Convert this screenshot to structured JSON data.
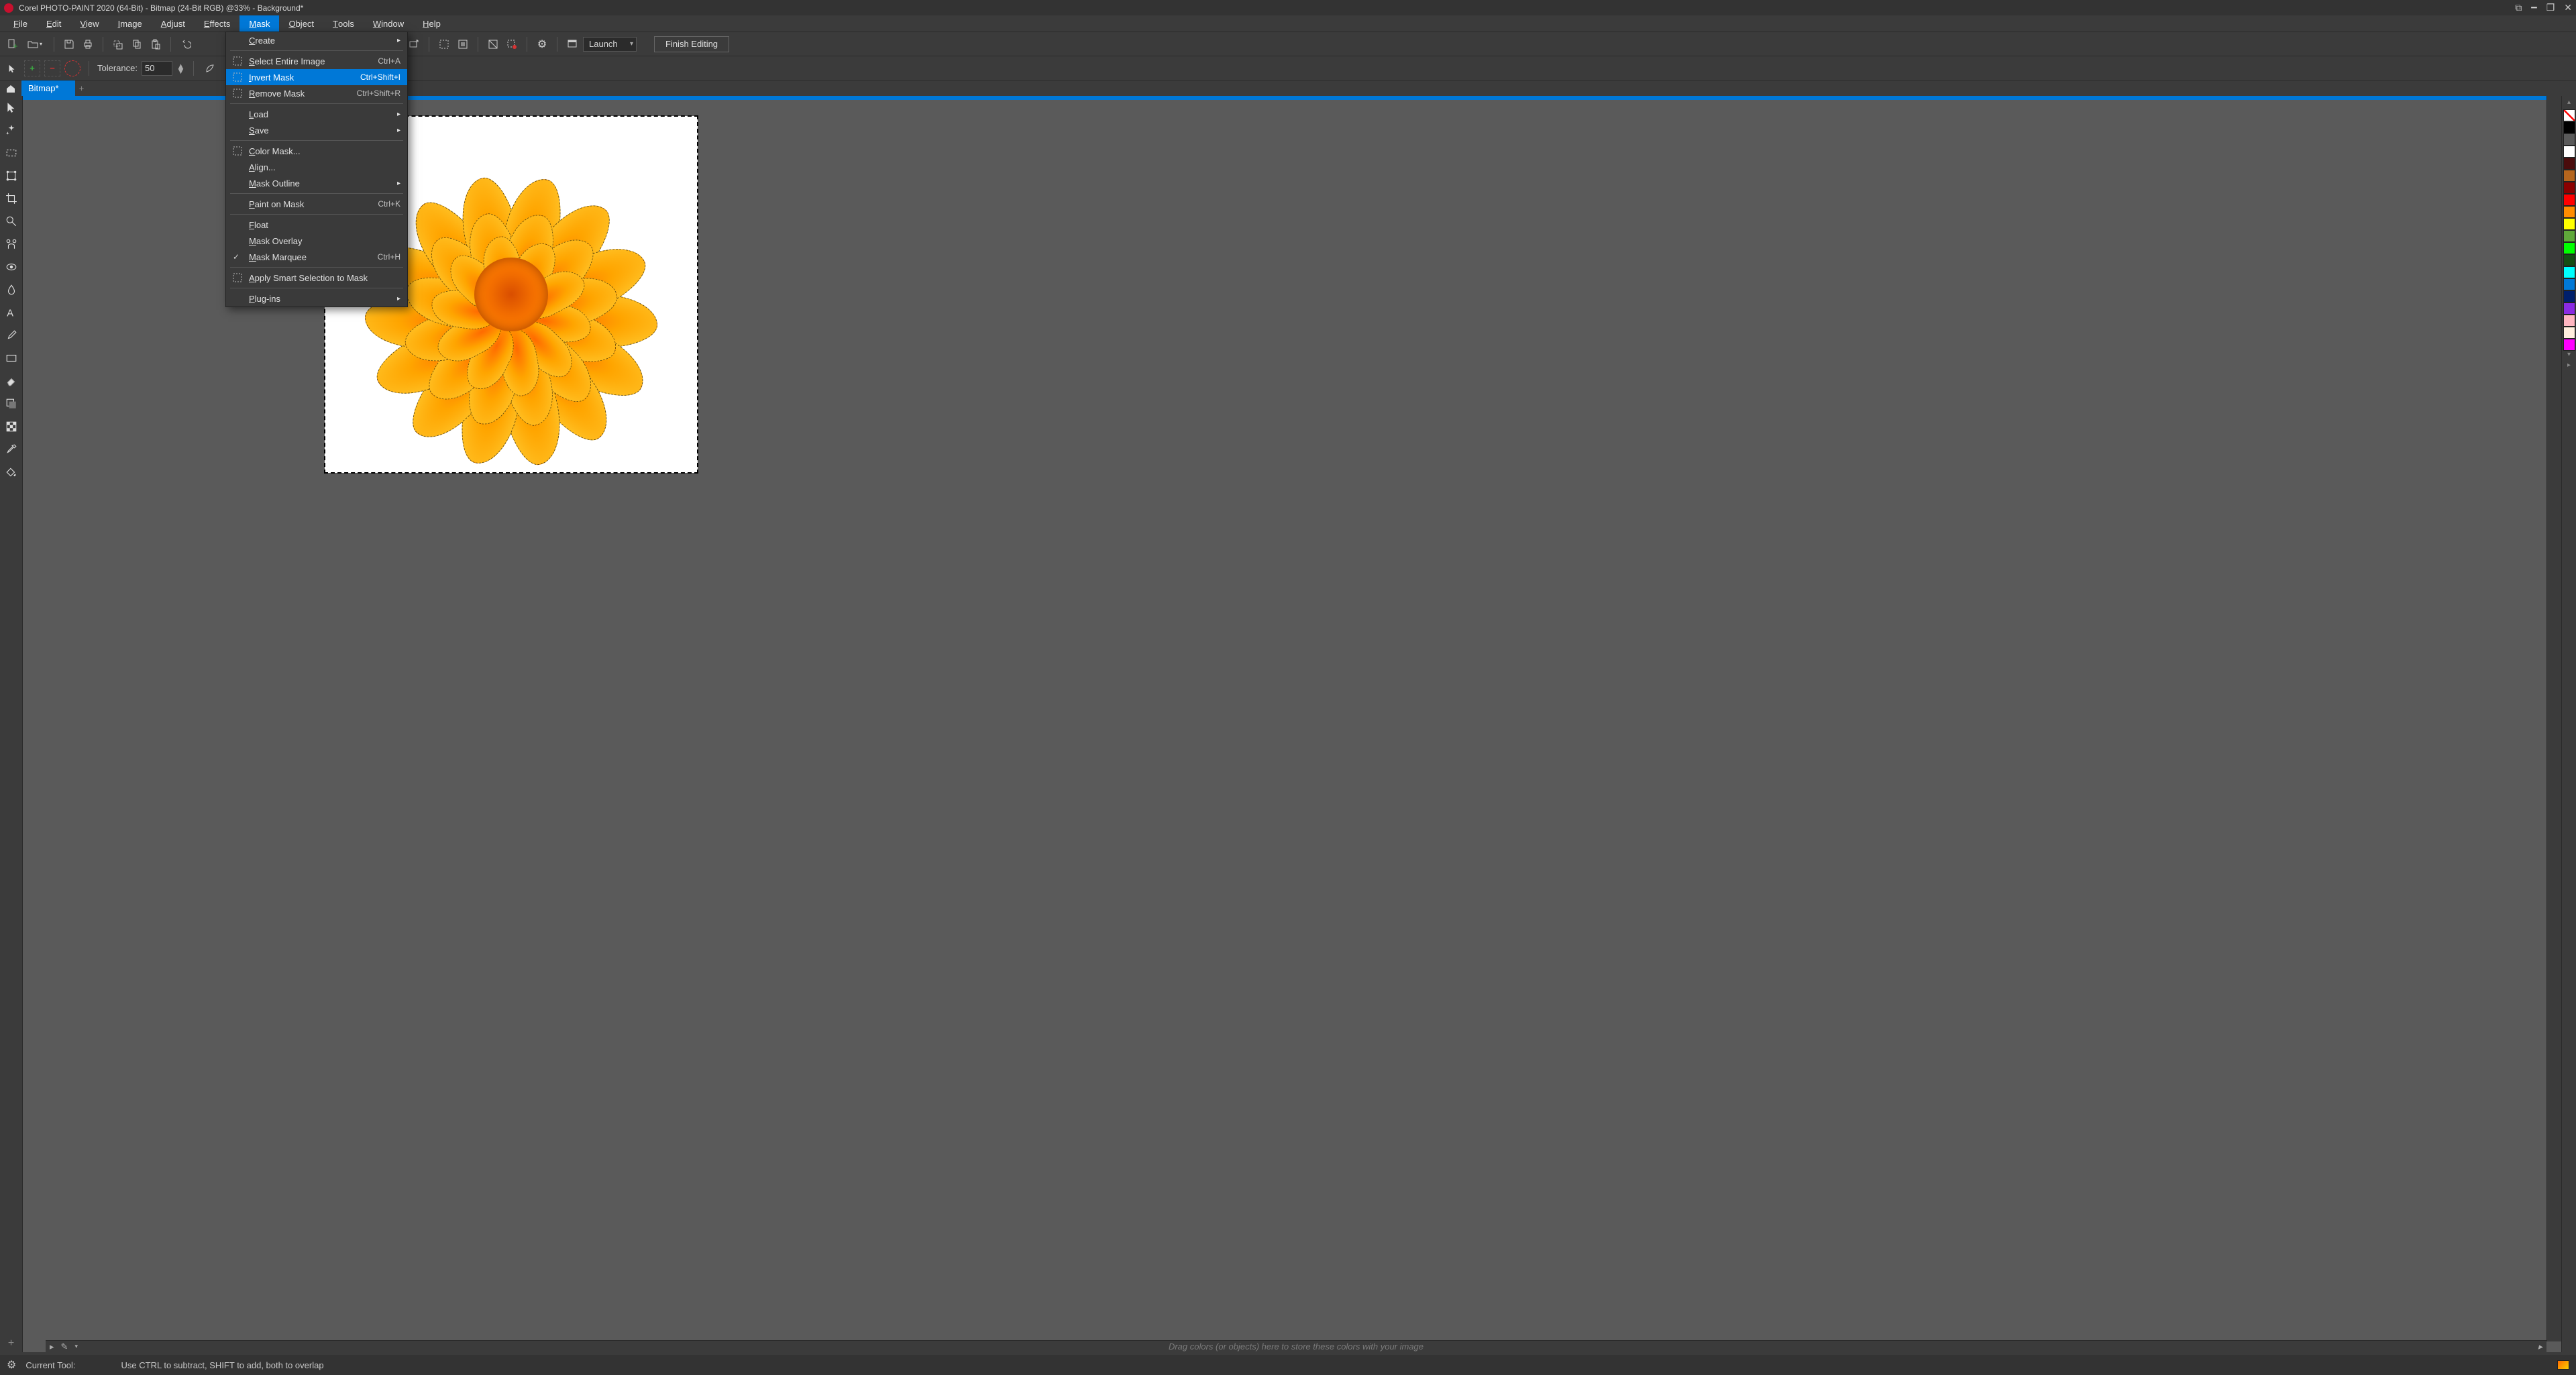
{
  "title_bar": {
    "text": "Corel PHOTO-PAINT 2020 (64-Bit) - Bitmap (24-Bit RGB) @33% - Background*"
  },
  "menu": {
    "items": [
      "File",
      "Edit",
      "View",
      "Image",
      "Adjust",
      "Effects",
      "Mask",
      "Object",
      "Tools",
      "Window",
      "Help"
    ],
    "active_index": 6
  },
  "toolbar": {
    "launch_label": "Launch",
    "finish_label": "Finish Editing"
  },
  "property_bar": {
    "tolerance_label": "Tolerance:",
    "tolerance_value": "50"
  },
  "tabs": {
    "doc_name": "Bitmap*"
  },
  "mask_menu": {
    "items": [
      {
        "label": "Create",
        "submenu": true
      },
      {
        "sep": true
      },
      {
        "label": "Select Entire Image",
        "shortcut": "Ctrl+A",
        "icon": "select-all-icon"
      },
      {
        "label": "Invert Mask",
        "shortcut": "Ctrl+Shift+I",
        "icon": "invert-icon",
        "highlighted": true
      },
      {
        "label": "Remove Mask",
        "shortcut": "Ctrl+Shift+R",
        "icon": "remove-icon"
      },
      {
        "sep": true
      },
      {
        "label": "Load",
        "submenu": true
      },
      {
        "label": "Save",
        "submenu": true
      },
      {
        "sep": true
      },
      {
        "label": "Color Mask...",
        "icon": "color-mask-icon"
      },
      {
        "label": "Align..."
      },
      {
        "label": "Mask Outline",
        "submenu": true
      },
      {
        "sep": true
      },
      {
        "label": "Paint on Mask",
        "shortcut": "Ctrl+K"
      },
      {
        "sep": true
      },
      {
        "label": "Float"
      },
      {
        "label": "Mask Overlay"
      },
      {
        "label": "Mask Marquee",
        "shortcut": "Ctrl+H",
        "checked": true
      },
      {
        "sep": true
      },
      {
        "label": "Apply Smart Selection to Mask",
        "icon": "smart-select-icon"
      },
      {
        "sep": true
      },
      {
        "label": "Plug-ins",
        "submenu": true
      }
    ]
  },
  "palette": {
    "colors": [
      "none",
      "#000000",
      "#5a5a5a",
      "#ffffff",
      "#4a0c0c",
      "#b5651d",
      "#8b0000",
      "#ff0000",
      "#ff8c00",
      "#ffff00",
      "#5fa83a",
      "#00ff00",
      "#144e14",
      "#00ffff",
      "#0078d7",
      "#001f6b",
      "#8a2be2",
      "#ffb6c1",
      "#ffeedd",
      "#ff00ff"
    ]
  },
  "color_tray": {
    "hint": "Drag colors (or objects) here to store these colors with your image"
  },
  "status": {
    "tool_label": "Current Tool:",
    "hint": "Use CTRL to subtract, SHIFT to add, both to overlap"
  }
}
